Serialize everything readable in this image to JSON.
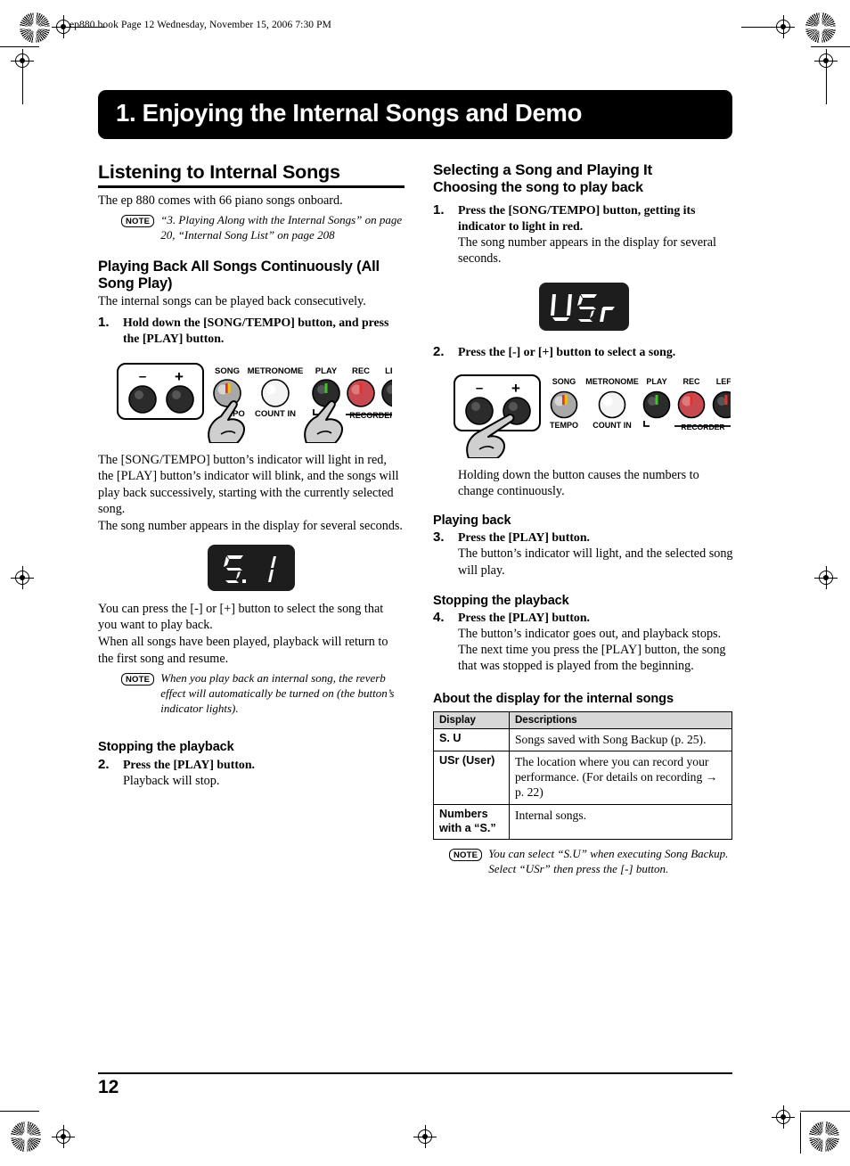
{
  "printer_header": {
    "text": "ep880.book  Page 12  Wednesday, November 15, 2006  7:30 PM"
  },
  "chapter": {
    "title": "1. Enjoying the Internal Songs and Demo"
  },
  "left_column": {
    "section_title": "Listening to Internal Songs",
    "intro": "The ep 880 comes with 66 piano songs onboard.",
    "intro_note": {
      "tag": "NOTE",
      "text": "“3. Playing Along with the Internal Songs” on page 20, “Internal Song List” on page 208"
    },
    "subsection_title": "Playing Back All Songs Continuously (All Song Play)",
    "subsection_intro": "The internal songs can be played back consecutively.",
    "step1": {
      "number": "1.",
      "lead": "Hold down the [SONG/TEMPO] button, and press the [PLAY] button.",
      "desc1": "The [SONG/TEMPO] button’s indicator will light in red, the [PLAY] button’s indicator will blink, and the songs will play back successively, starting with the currently selected song.",
      "desc2": "The song number appears in the display for several seconds."
    },
    "display_value": "S. 1",
    "after_display_1": "You can press the [-] or [+] button to select the song that you want to play back.",
    "after_display_2": "When all songs have been played, playback will return to the first song and resume.",
    "reverb_note": {
      "tag": "NOTE",
      "text": "When you play back an internal song, the reverb effect will automatically be turned on (the button’s indicator lights)."
    },
    "stopping_title": "Stopping the playback",
    "step2": {
      "number": "2.",
      "lead": "Press the [PLAY] button.",
      "desc": "Playback will stop."
    }
  },
  "right_column": {
    "section_title": "Selecting a Song and Playing It",
    "subsection_title": "Choosing the song to play back",
    "step1": {
      "number": "1.",
      "lead": "Press the [SONG/TEMPO] button, getting its indicator to light in red.",
      "desc": "The song number appears in the display for several seconds."
    },
    "display_value": "USr",
    "step2": {
      "number": "2.",
      "lead": "Press the [-] or [+] button to select a song.",
      "desc": "Holding down the button causes the numbers to change continuously."
    },
    "playing_back_title": "Playing back",
    "step3": {
      "number": "3.",
      "lead": "Press the [PLAY] button.",
      "desc": "The button’s indicator will light, and the selected song will play."
    },
    "stopping_title": "Stopping the playback",
    "step4": {
      "number": "4.",
      "lead": "Press the [PLAY] button.",
      "desc": "The button’s indicator goes out, and playback stops. The next time you press the [PLAY] button, the song that was stopped is played from the beginning."
    },
    "about_display_title": "About the display for the internal songs",
    "table": {
      "headers": [
        "Display",
        "Descriptions"
      ],
      "rows": [
        {
          "key": "S. U",
          "value": "Songs saved with Song Backup (p. 25)."
        },
        {
          "key": "USr (User)",
          "value": "The location where you can record your performance. (For details on recording → p. 22)"
        },
        {
          "key": "Numbers with a “S.”",
          "value": "Internal songs."
        }
      ]
    },
    "table_note": {
      "tag": "NOTE",
      "text": "You can select “S.U” when executing Song Backup. Select “USr” then press the [-] button."
    }
  },
  "panel_illustration": {
    "labels": {
      "minus": "–",
      "plus": "+",
      "song": "SONG",
      "tempo": "TEMPO",
      "tempo_partial": "MPO",
      "metronome": "METRONOME",
      "count_in": "COUNT IN",
      "play": "PLAY",
      "rec": "REC",
      "left": "LEFT",
      "recorder": "RECORDER"
    },
    "colors": {
      "led_red": "#e8302a",
      "led_green": "#3fc12a",
      "led_yellow": "#f2c400",
      "rec_button": "#c8494f",
      "knob_dark": "#2b2b2b",
      "knob_grey": "#a8a8a8",
      "knob_white": "#f2f2f2",
      "hand_fill": "#cfcfcf"
    }
  },
  "footer": {
    "page_number": "12"
  }
}
